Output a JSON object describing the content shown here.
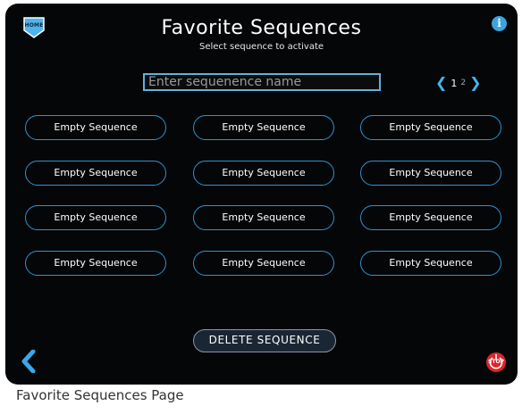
{
  "header": {
    "home_label": "HOME",
    "title": "Favorite Sequences",
    "subtitle": "Select sequence to activate",
    "info_glyph": "i"
  },
  "search": {
    "placeholder": "Enter sequenence name",
    "value": ""
  },
  "pagination": {
    "prev_glyph": "❮",
    "pages": [
      "1",
      "2"
    ],
    "current_page": "1",
    "next_glyph": "❯"
  },
  "sequences": [
    "Empty Sequence",
    "Empty Sequence",
    "Empty Sequence",
    "Empty Sequence",
    "Empty Sequence",
    "Empty Sequence",
    "Empty Sequence",
    "Empty Sequence",
    "Empty Sequence",
    "Empty Sequence",
    "Empty Sequence",
    "Empty Sequence"
  ],
  "actions": {
    "delete_label": "DELETE SEQUENCE",
    "stop_label": "STOP"
  },
  "icons": {
    "home": "home-badge-icon",
    "info": "info-icon",
    "back": "chevron-left-icon",
    "stop": "power-stop-icon"
  },
  "colors": {
    "background": "#050608",
    "accent": "#2f93d1",
    "stop": "#d9262c"
  },
  "caption": "Favorite Sequences Page"
}
